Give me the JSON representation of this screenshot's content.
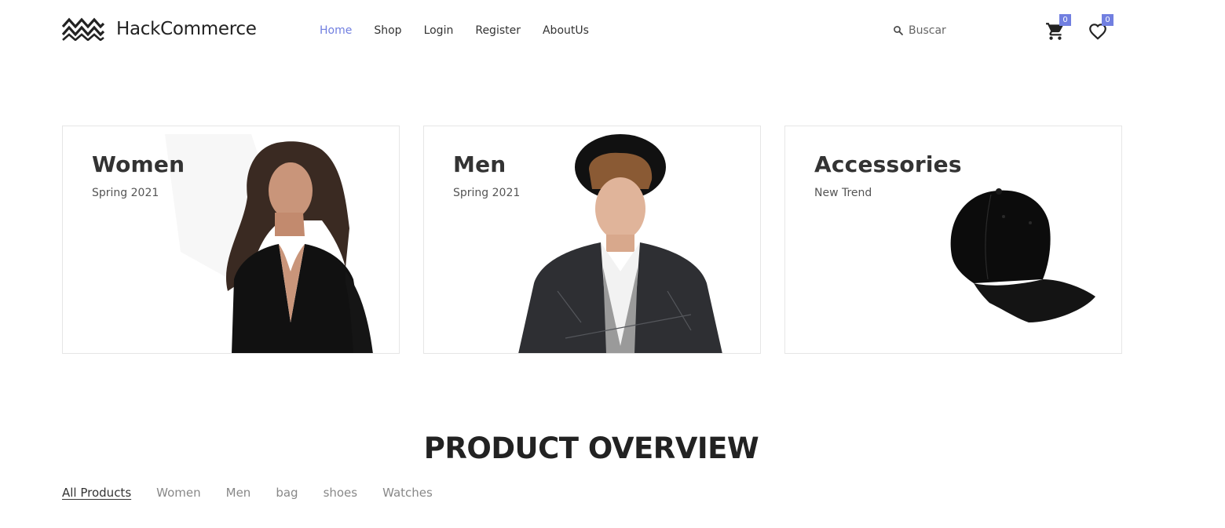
{
  "brand": {
    "name": "HackCommerce",
    "logo_icon": "wave-logo-icon"
  },
  "nav": {
    "items": [
      {
        "label": "Home",
        "active": true
      },
      {
        "label": "Shop",
        "active": false
      },
      {
        "label": "Login",
        "active": false
      },
      {
        "label": "Register",
        "active": false
      },
      {
        "label": "AboutUs",
        "active": false
      }
    ]
  },
  "search": {
    "placeholder": "Buscar",
    "icon": "search-icon"
  },
  "cart": {
    "icon": "cart-icon",
    "count": "0"
  },
  "wishlist": {
    "icon": "heart-icon",
    "count": "0"
  },
  "banners": [
    {
      "title": "Women",
      "subtitle": "Spring 2021"
    },
    {
      "title": "Men",
      "subtitle": "Spring 2021"
    },
    {
      "title": "Accessories",
      "subtitle": "New Trend"
    }
  ],
  "overview": {
    "title": "PRODUCT OVERVIEW",
    "filters": [
      {
        "label": "All Products",
        "active": true
      },
      {
        "label": "Women",
        "active": false
      },
      {
        "label": "Men",
        "active": false
      },
      {
        "label": "bag",
        "active": false
      },
      {
        "label": "shoes",
        "active": false
      },
      {
        "label": "Watches",
        "active": false
      }
    ]
  },
  "colors": {
    "accent": "#717fe0",
    "text": "#333333",
    "muted": "#888888",
    "border": "#e6e6e6"
  }
}
